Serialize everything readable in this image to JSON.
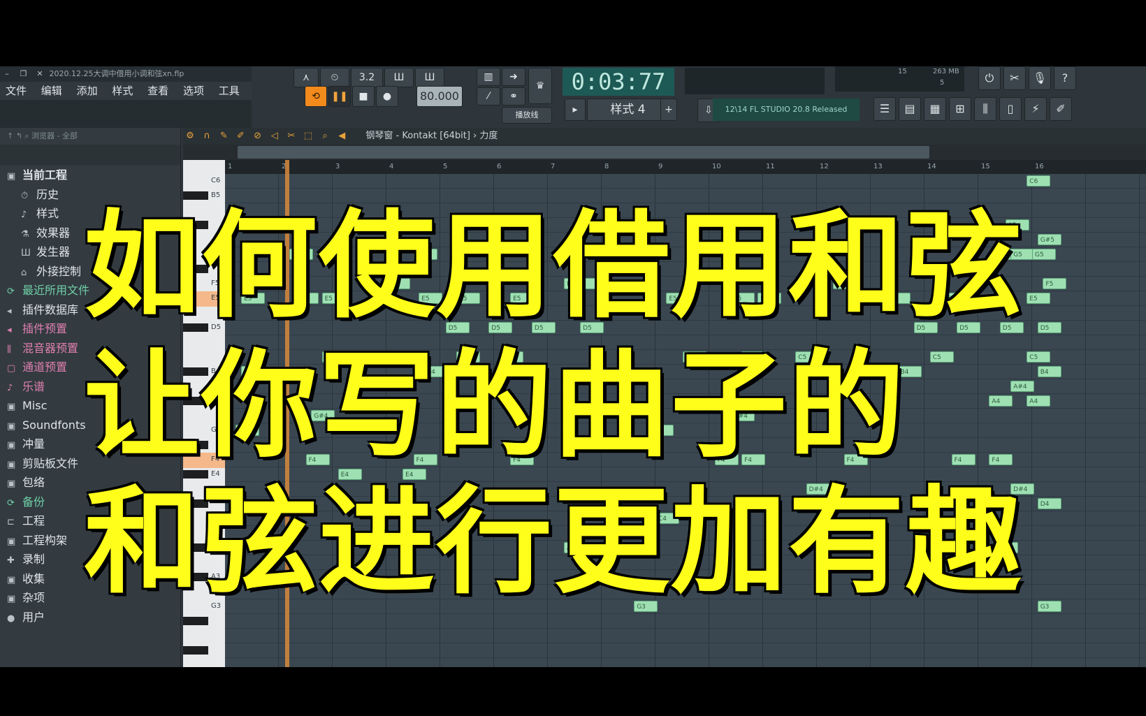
{
  "window": {
    "file_title": "2020.12.25大调中借用小调和弦xn.flp",
    "min": "–",
    "restore": "❐",
    "close": "✕"
  },
  "menu": [
    "文件",
    "编辑",
    "添加",
    "样式",
    "查看",
    "选项",
    "工具",
    "?"
  ],
  "transport": {
    "tempo": "80.000",
    "time": "0:03:77",
    "time_unit": "M:S:CS",
    "snap_label": "播放线",
    "pattern": "样式 4",
    "mem": "263 MB",
    "cpu": "15",
    "poly": "5",
    "version_hint": "12\\14  FL STUDIO 20.8 Released",
    "mode_label": "3.2"
  },
  "browser": {
    "header": "浏览器 - 全部",
    "items": [
      {
        "label": "当前工程",
        "icon": "folder",
        "style": "bold"
      },
      {
        "label": "历史",
        "icon": "history",
        "style": "sub"
      },
      {
        "label": "样式",
        "icon": "note",
        "style": "sub"
      },
      {
        "label": "效果器",
        "icon": "fx",
        "style": "sub"
      },
      {
        "label": "发生器",
        "icon": "gen",
        "style": "sub"
      },
      {
        "label": "外接控制",
        "icon": "ctrl",
        "style": "sub"
      },
      {
        "label": "最近所用文件",
        "icon": "recent",
        "style": "green"
      },
      {
        "label": "插件数据库",
        "icon": "plug",
        "style": "normal"
      },
      {
        "label": "插件预置",
        "icon": "plug",
        "style": "pink"
      },
      {
        "label": "混音器预置",
        "icon": "mixer",
        "style": "pink"
      },
      {
        "label": "通道预置",
        "icon": "channel",
        "style": "pink"
      },
      {
        "label": "乐谱",
        "icon": "note",
        "style": "pink"
      },
      {
        "label": "Misc",
        "icon": "folder",
        "style": "normal"
      },
      {
        "label": "Soundfonts",
        "icon": "folder",
        "style": "normal"
      },
      {
        "label": "冲量",
        "icon": "folder",
        "style": "normal"
      },
      {
        "label": "剪贴板文件",
        "icon": "folder",
        "style": "normal"
      },
      {
        "label": "包络",
        "icon": "folder",
        "style": "normal"
      },
      {
        "label": "备份",
        "icon": "recent",
        "style": "green"
      },
      {
        "label": "工程",
        "icon": "project",
        "style": "normal"
      },
      {
        "label": "工程构架",
        "icon": "folder",
        "style": "normal"
      },
      {
        "label": "录制",
        "icon": "record",
        "style": "normal"
      },
      {
        "label": "收集",
        "icon": "folder",
        "style": "normal"
      },
      {
        "label": "杂项",
        "icon": "folder",
        "style": "normal"
      },
      {
        "label": "用户",
        "icon": "user",
        "style": "normal"
      }
    ]
  },
  "piano_roll": {
    "title": "钢琴窗 - Kontakt [64bit]",
    "target": "力度",
    "bars": [
      "1",
      "2",
      "3",
      "4",
      "5",
      "6",
      "7",
      "8",
      "9",
      "10",
      "11",
      "12",
      "13",
      "14",
      "15",
      "16"
    ],
    "key_labels": [
      "C6",
      "B5",
      "G5",
      "F5",
      "E5",
      "D5",
      "B4",
      "A4",
      "G4",
      "F4",
      "E4",
      "C4",
      "B3",
      "A3",
      "G3"
    ],
    "notes": [
      {
        "label": "C6",
        "bar": 15.9,
        "row": 0
      },
      {
        "label": "A5",
        "bar": 15.5,
        "row": 3
      },
      {
        "label": "G#5",
        "bar": 16.1,
        "row": 4
      },
      {
        "label": "G5",
        "bar": 2.2,
        "row": 5
      },
      {
        "label": "G5",
        "bar": 4.5,
        "row": 5
      },
      {
        "label": "G5",
        "bar": 15.3,
        "row": 5
      },
      {
        "label": "G5",
        "bar": 15.6,
        "row": 5
      },
      {
        "label": "G5",
        "bar": 16.0,
        "row": 5
      },
      {
        "label": "F5",
        "bar": 4.0,
        "row": 7
      },
      {
        "label": "F5",
        "bar": 7.3,
        "row": 7
      },
      {
        "label": "F5",
        "bar": 7.5,
        "row": 7
      },
      {
        "label": "F5",
        "bar": 12.3,
        "row": 7
      },
      {
        "label": "F5",
        "bar": 16.2,
        "row": 7
      },
      {
        "label": "E5",
        "bar": 1.3,
        "row": 8
      },
      {
        "label": "E5",
        "bar": 2.3,
        "row": 8
      },
      {
        "label": "E5",
        "bar": 2.8,
        "row": 8
      },
      {
        "label": "E5",
        "bar": 4.6,
        "row": 8
      },
      {
        "label": "E5",
        "bar": 5.3,
        "row": 8
      },
      {
        "label": "E5",
        "bar": 6.3,
        "row": 8
      },
      {
        "label": "E5",
        "bar": 9.2,
        "row": 8
      },
      {
        "label": "E5",
        "bar": 10.4,
        "row": 8
      },
      {
        "label": "E5",
        "bar": 10.9,
        "row": 8
      },
      {
        "label": "E5",
        "bar": 13.0,
        "row": 8
      },
      {
        "label": "E5",
        "bar": 13.3,
        "row": 8
      },
      {
        "label": "E5",
        "bar": 14.3,
        "row": 8
      },
      {
        "label": "E5",
        "bar": 15.9,
        "row": 8
      },
      {
        "label": "D5",
        "bar": 5.1,
        "row": 10
      },
      {
        "label": "D5",
        "bar": 5.9,
        "row": 10
      },
      {
        "label": "D5",
        "bar": 6.7,
        "row": 10
      },
      {
        "label": "D5",
        "bar": 7.6,
        "row": 10
      },
      {
        "label": "D5",
        "bar": 13.8,
        "row": 10
      },
      {
        "label": "D5",
        "bar": 14.6,
        "row": 10
      },
      {
        "label": "D5",
        "bar": 15.4,
        "row": 10
      },
      {
        "label": "D5",
        "bar": 16.1,
        "row": 10
      },
      {
        "label": "C5",
        "bar": 2.8,
        "row": 12
      },
      {
        "label": "C5",
        "bar": 4.3,
        "row": 12
      },
      {
        "label": "C5",
        "bar": 5.3,
        "row": 12
      },
      {
        "label": "C5",
        "bar": 6.1,
        "row": 12
      },
      {
        "label": "C5",
        "bar": 9.5,
        "row": 12
      },
      {
        "label": "C5",
        "bar": 10.6,
        "row": 12
      },
      {
        "label": "C5",
        "bar": 11.6,
        "row": 12
      },
      {
        "label": "C5",
        "bar": 14.1,
        "row": 12
      },
      {
        "label": "C5",
        "bar": 15.9,
        "row": 12
      },
      {
        "label": "B4",
        "bar": 1.3,
        "row": 13
      },
      {
        "label": "B4",
        "bar": 4.7,
        "row": 13
      },
      {
        "label": "B4",
        "bar": 6.1,
        "row": 13
      },
      {
        "label": "B4",
        "bar": 13.5,
        "row": 13
      },
      {
        "label": "B4",
        "bar": 16.1,
        "row": 13
      },
      {
        "label": "A#4",
        "bar": 15.6,
        "row": 14
      },
      {
        "label": "A4",
        "bar": 15.2,
        "row": 15
      },
      {
        "label": "A4",
        "bar": 15.9,
        "row": 15
      },
      {
        "label": "G#4",
        "bar": 2.6,
        "row": 16
      },
      {
        "label": "G#4",
        "bar": 10.4,
        "row": 16
      },
      {
        "label": "G4",
        "bar": 1.2,
        "row": 17
      },
      {
        "label": "G4",
        "bar": 8.9,
        "row": 17
      },
      {
        "label": "F4",
        "bar": 2.5,
        "row": 19
      },
      {
        "label": "F4",
        "bar": 4.5,
        "row": 19
      },
      {
        "label": "F4",
        "bar": 6.3,
        "row": 19
      },
      {
        "label": "F4",
        "bar": 10.1,
        "row": 19
      },
      {
        "label": "F4",
        "bar": 10.6,
        "row": 19
      },
      {
        "label": "F4",
        "bar": 12.5,
        "row": 19
      },
      {
        "label": "F4",
        "bar": 14.5,
        "row": 19
      },
      {
        "label": "F4",
        "bar": 15.2,
        "row": 19
      },
      {
        "label": "E4",
        "bar": 3.1,
        "row": 20
      },
      {
        "label": "E4",
        "bar": 4.3,
        "row": 20
      },
      {
        "label": "D#4",
        "bar": 15.6,
        "row": 21
      },
      {
        "label": "D#4",
        "bar": 11.8,
        "row": 21
      },
      {
        "label": "D4",
        "bar": 16.1,
        "row": 22
      },
      {
        "label": "D4",
        "bar": 12.6,
        "row": 22
      },
      {
        "label": "C4",
        "bar": 9.0,
        "row": 23
      },
      {
        "label": "A#3",
        "bar": 7.3,
        "row": 25
      },
      {
        "label": "A#3",
        "bar": 15.3,
        "row": 25
      },
      {
        "label": "G3",
        "bar": 8.6,
        "row": 29
      },
      {
        "label": "G3",
        "bar": 16.1,
        "row": 29
      }
    ]
  },
  "overlay": {
    "line1": "如何使用借用和弦",
    "line2": "让你写的曲子的",
    "line3": "和弦进行更加有趣"
  },
  "colors": {
    "headline": "#fffd1a",
    "accent_orange": "#f28a1c",
    "note_fill": "#9fe0b3"
  }
}
